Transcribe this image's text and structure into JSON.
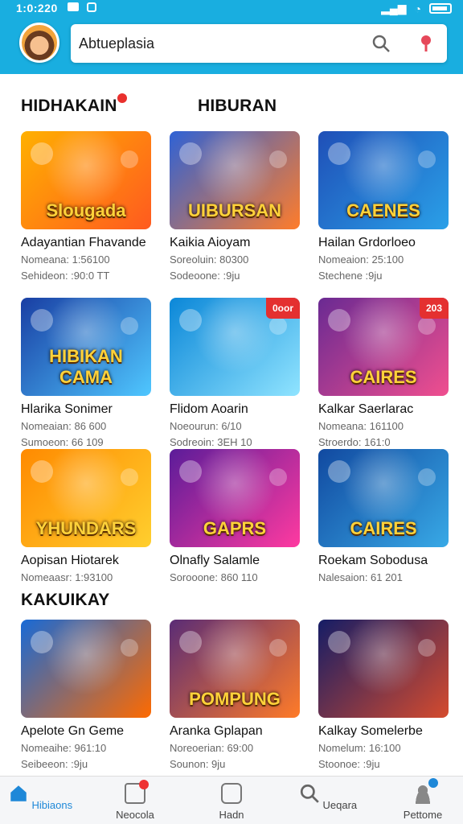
{
  "status": {
    "time": "1:0:220"
  },
  "search": {
    "value": "Abtueplasia"
  },
  "sections": {
    "left_title": "HIDHAKAIN",
    "right_title": "HIBURAN",
    "second_title": "KAKUIKAY"
  },
  "cards": [
    {
      "name": "Adayantian Fhavande",
      "meta1": "Nomeana: 1:56100",
      "meta2": "Sehideon: :90:0 TT",
      "thumb_text": "Slougada",
      "colors": [
        "#ffb000",
        "#ff5a1f"
      ],
      "badge": ""
    },
    {
      "name": "Kaikia Aioyam",
      "meta1": "Soreoluin: 80300",
      "meta2": "Sodeoone: :9ju",
      "thumb_text": "UIBURSAN",
      "colors": [
        "#2e62d6",
        "#ff7c2a"
      ],
      "badge": ""
    },
    {
      "name": "Hailan Grdorloeo",
      "meta1": "Nomeaion: 25:100",
      "meta2": "Stechene :9ju",
      "thumb_text": "CAENES",
      "colors": [
        "#1f4fb7",
        "#2aa0e8"
      ],
      "badge": ""
    },
    {
      "name": "Hlarika Sonimer",
      "meta1": "Nomeaian: 86 600",
      "meta2": "Sumoeon: 66 109",
      "thumb_text": "HIBIKAN CAMA",
      "colors": [
        "#193ea3",
        "#4fc7ff"
      ],
      "badge": ""
    },
    {
      "name": "Flidom Aoarin",
      "meta1": "Noeourun: 6/10",
      "meta2": "Sodreoin: 3EH 10",
      "thumb_text": "",
      "colors": [
        "#0b87d8",
        "#90e4ff"
      ],
      "badge": "0oor"
    },
    {
      "name": "Kalkar Saerlarac",
      "meta1": "Nomeana: 161100",
      "meta2": "Stroerdo: 161:0",
      "thumb_text": "CAIRES",
      "colors": [
        "#6a2a92",
        "#f04f8f"
      ],
      "badge": "203"
    },
    {
      "name": "Aopisan Hiotarek",
      "meta1": "Nomeaasr: 1:93100",
      "meta2": "",
      "thumb_text": "YHUNDARS",
      "colors": [
        "#ff8a00",
        "#ffcf2e"
      ],
      "badge": ""
    },
    {
      "name": "Olnafly Salamle",
      "meta1": "Sorooone: 860 110",
      "meta2": "",
      "thumb_text": "GAPRS",
      "colors": [
        "#5b1c99",
        "#ff3aa0"
      ],
      "badge": ""
    },
    {
      "name": "Roekam Sobodusa",
      "meta1": "Nalesaion: 61 201",
      "meta2": "",
      "thumb_text": "CAIRES",
      "colors": [
        "#1149a0",
        "#38a9e6"
      ],
      "badge": ""
    },
    {
      "name": "Apelote Gn Geme",
      "meta1": "Nomeaihe: 961:10",
      "meta2": "Seibeeon: :9ju",
      "thumb_text": "",
      "colors": [
        "#186ad6",
        "#fe6a00"
      ],
      "badge": ""
    },
    {
      "name": "Aranka Gplapan",
      "meta1": "Noreoerian: 69:00",
      "meta2": "Sounon: 9ju",
      "thumb_text": "POMPUNG",
      "colors": [
        "#5a2c76",
        "#ff7b28"
      ],
      "badge": ""
    },
    {
      "name": "Kalkay Somelerbe",
      "meta1": "Nomelum: 16:100",
      "meta2": "Stoonoe: :9ju",
      "thumb_text": "",
      "colors": [
        "#151d66",
        "#d54b2e"
      ],
      "badge": ""
    }
  ],
  "nav": [
    {
      "label": "Hibiaons"
    },
    {
      "label": "Neocola"
    },
    {
      "label": "Hadn"
    },
    {
      "label": "Ueqara"
    },
    {
      "label": "Pettome"
    }
  ]
}
